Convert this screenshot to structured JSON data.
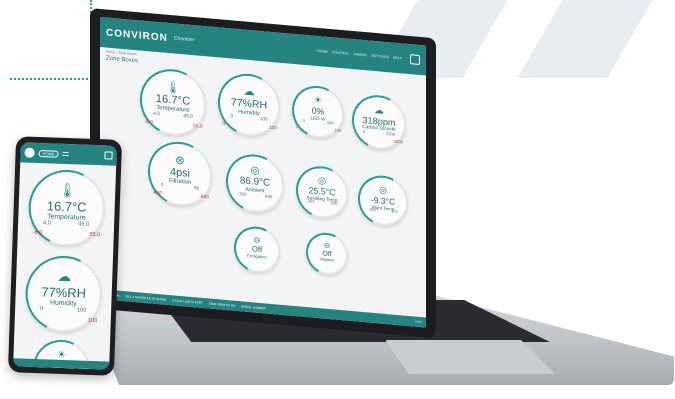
{
  "brand": {
    "logo_text": "CONVIRON",
    "subtitle": "Chamber"
  },
  "breadcrumb": "Home  /  Zone Boxes",
  "page_title": "Zone Boxes",
  "nav": [
    "HOME",
    "CONTROL",
    "TRENDS",
    "SETTINGS",
    "HELP"
  ],
  "status_bar": {
    "alarm": "NO ALARM",
    "items": [
      "25.5  ●  SCHEDULE STOPPED",
      "CYCLE LIGHTS STEP",
      "SAVE GRAPHS ON",
      "SERIAL NUMBER"
    ],
    "right": "EXIT"
  },
  "laptop_gauges": [
    {
      "icon": "thermometer-icon",
      "glyph": "🌡",
      "value": "16.7°C",
      "label": "Temperature",
      "lo": "4.0",
      "hi": "45.0",
      "min": "-6.0",
      "max": "55.0"
    },
    {
      "icon": "cloud-rain-icon",
      "glyph": "☁",
      "value": "77%RH",
      "label": "Humidity",
      "lo": "0",
      "hi": "100",
      "min": "0",
      "max": "100"
    },
    {
      "icon": "sun-icon",
      "glyph": "☀",
      "value": "0%",
      "label": "LED-W",
      "lo": "0",
      "hi": "100",
      "min": "0",
      "max": "100"
    },
    {
      "icon": "cloud-icon",
      "glyph": "☁",
      "value": "318ppm",
      "label": "Carbon Dioxide",
      "lo": "0",
      "hi": "2000",
      "min": "",
      "max": "3000"
    },
    {
      "icon": "aperture-icon",
      "glyph": "⊛",
      "value": "4psi",
      "label": "Filtration",
      "lo": "0",
      "hi": "56",
      "min": "-640",
      "max": "640"
    },
    {
      "icon": "target-icon",
      "glyph": "◎",
      "value": "86.9°C",
      "label": "Ambient",
      "lo": "-303",
      "hi": "960",
      "min": "",
      "max": ""
    },
    {
      "icon": "target-icon",
      "glyph": "◎",
      "value": "25.5°C",
      "label": "Seedling Temp",
      "lo": "-303",
      "hi": "200",
      "min": "",
      "max": ""
    },
    {
      "icon": "target-icon",
      "glyph": "◎",
      "value": "-9.3°C",
      "label": "Plant Temp",
      "lo": "-303",
      "hi": "100",
      "min": "",
      "max": ""
    },
    {
      "icon": "pulse-icon",
      "glyph": "⊖",
      "value": "Off",
      "label": "Fertigation",
      "lo": "",
      "hi": "",
      "min": "",
      "max": ""
    },
    {
      "icon": "pulse-icon",
      "glyph": "⊖",
      "value": "Off",
      "label": "Irrigation",
      "lo": "",
      "hi": "",
      "min": "",
      "max": ""
    }
  ],
  "phone": {
    "pill": "HOME",
    "gauges": [
      {
        "icon": "thermometer-icon",
        "glyph": "🌡",
        "value": "16.7°C",
        "label": "Temperature",
        "lo": "4.0",
        "hi": "45.0",
        "min": "-6.0",
        "max": "55.0"
      },
      {
        "icon": "cloud-rain-icon",
        "glyph": "☁",
        "value": "77%RH",
        "label": "Humidity",
        "lo": "0",
        "hi": "100",
        "min": "",
        "max": "100"
      },
      {
        "icon": "sun-icon",
        "glyph": "☀",
        "value": "",
        "label": "",
        "lo": "",
        "hi": "",
        "min": "",
        "max": ""
      }
    ]
  },
  "colors": {
    "accent": "#258380",
    "arc": "#2a9d9a",
    "limit": "#c0392b"
  }
}
